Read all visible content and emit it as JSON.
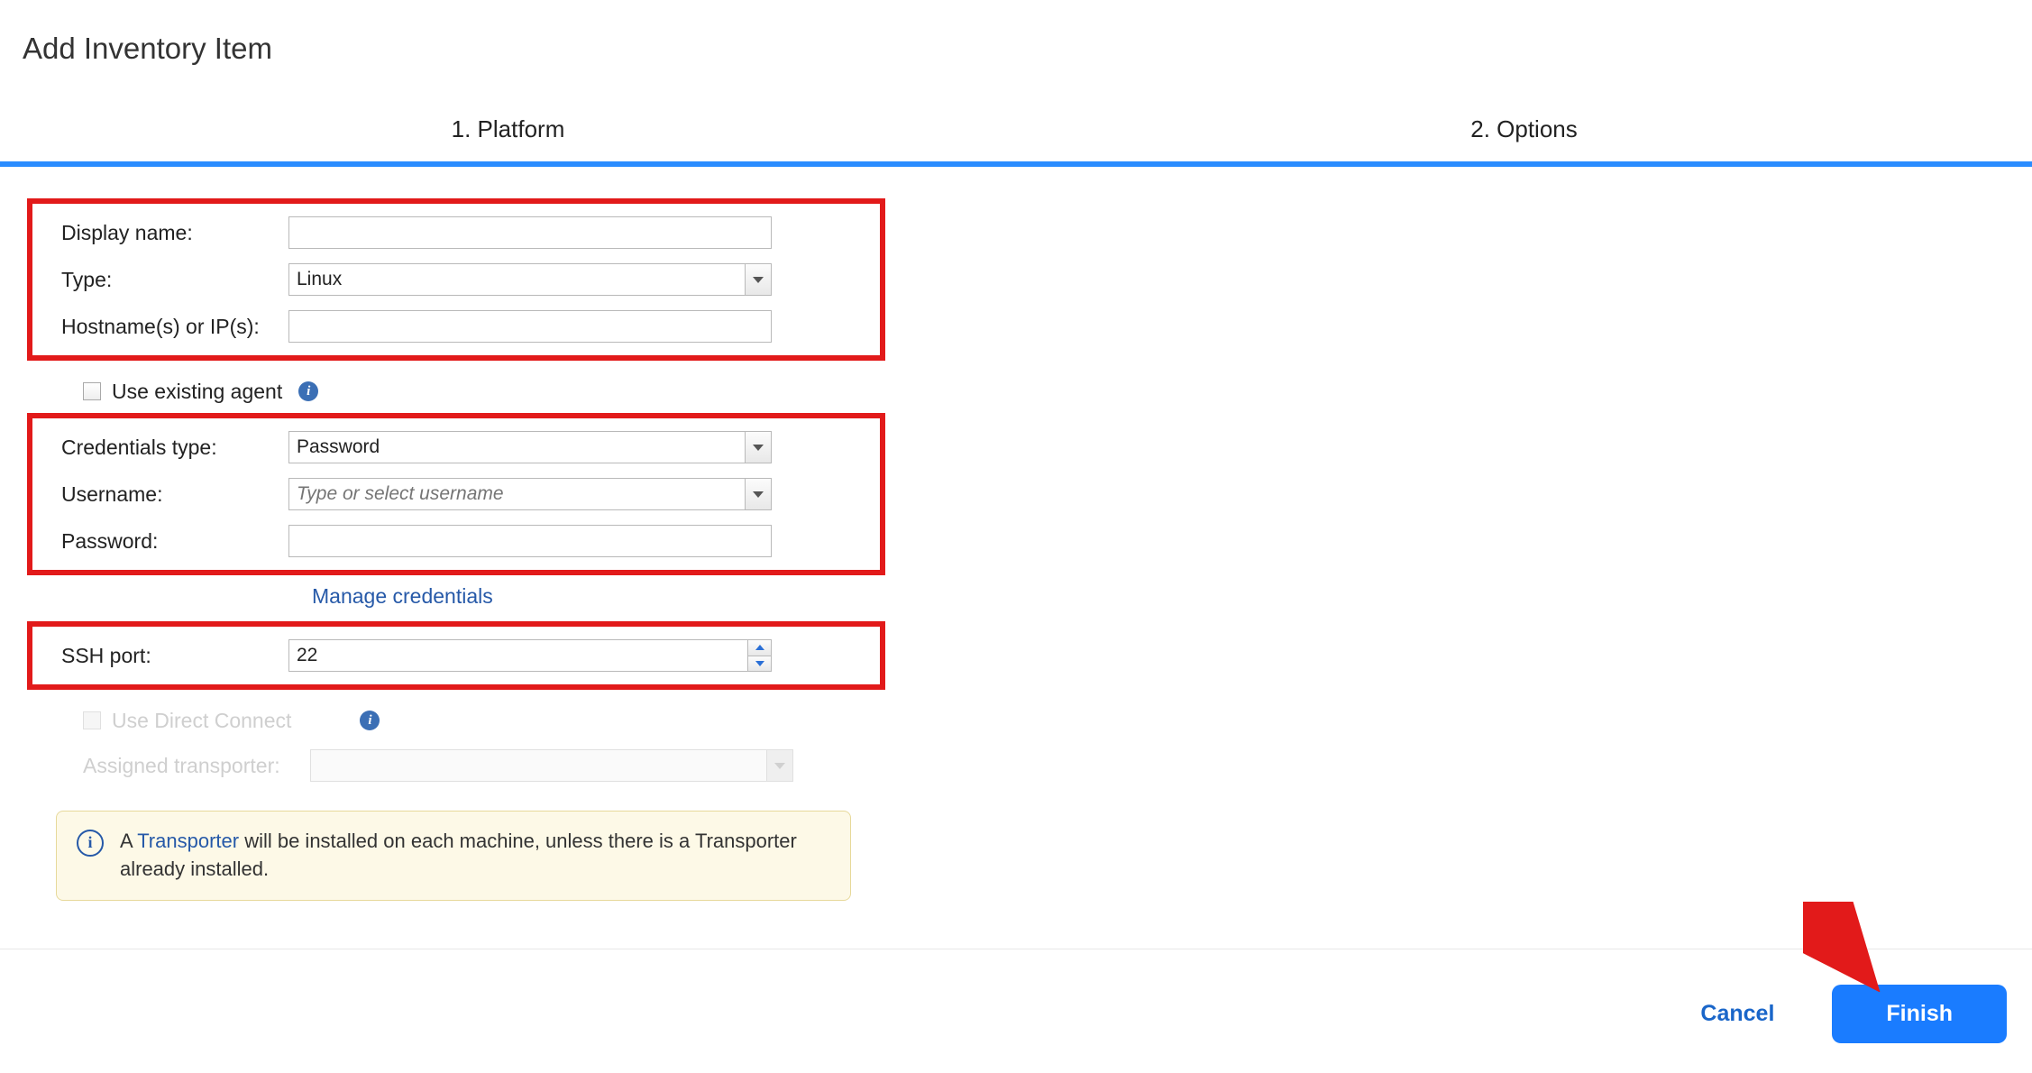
{
  "title": "Add Inventory Item",
  "steps": {
    "step1": "1. Platform",
    "step2": "2. Options"
  },
  "form": {
    "display_name": {
      "label": "Display name:",
      "value": ""
    },
    "type": {
      "label": "Type:",
      "value": "Linux"
    },
    "hostnames": {
      "label": "Hostname(s) or IP(s):",
      "value": ""
    },
    "use_existing_agent": {
      "label": "Use existing agent"
    },
    "credentials_type": {
      "label": "Credentials type:",
      "value": "Password"
    },
    "username": {
      "label": "Username:",
      "placeholder": "Type or select username",
      "value": ""
    },
    "password": {
      "label": "Password:",
      "value": ""
    },
    "manage_credentials": "Manage credentials",
    "ssh_port": {
      "label": "SSH port:",
      "value": "22"
    },
    "use_direct_connect": {
      "label": "Use Direct Connect"
    },
    "assigned_transporter": {
      "label": "Assigned transporter:",
      "value": ""
    },
    "info_banner": {
      "prefix": "A ",
      "link": "Transporter",
      "suffix": " will be installed on each machine, unless there is a Transporter already installed."
    }
  },
  "buttons": {
    "cancel": "Cancel",
    "finish": "Finish"
  }
}
